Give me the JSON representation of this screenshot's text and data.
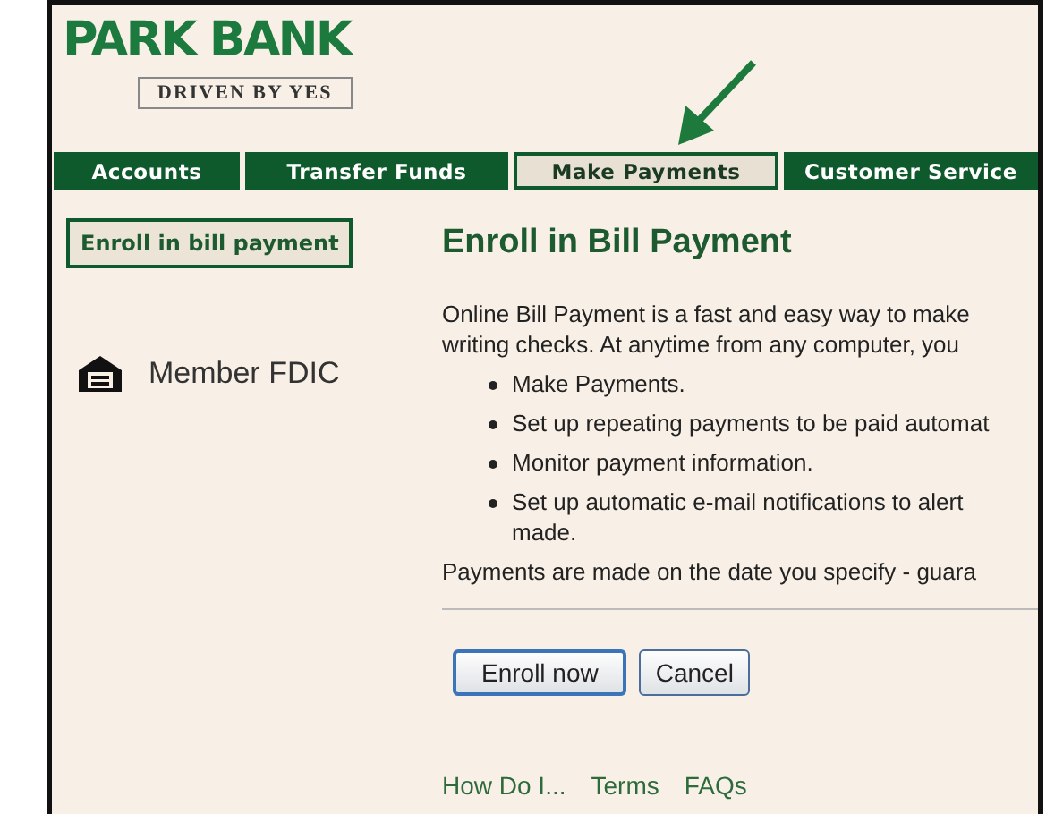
{
  "logo": {
    "name": "PARK BANK",
    "tagline": "DRIVEN BY YES"
  },
  "tabs": [
    {
      "label": "Accounts",
      "selected": false
    },
    {
      "label": "Transfer Funds",
      "selected": false
    },
    {
      "label": "Make Payments",
      "selected": true
    },
    {
      "label": "Customer Service",
      "selected": false
    }
  ],
  "sidebar": {
    "link": "Enroll in bill payment",
    "fdic": "Member FDIC"
  },
  "main": {
    "title": "Enroll in Bill Payment",
    "intro": [
      "Online Bill Payment is a fast and easy way to make",
      "writing checks. At anytime from any computer, you"
    ],
    "bullets": [
      [
        "Make Payments."
      ],
      [
        "Set up repeating payments to be paid automat"
      ],
      [
        "Monitor payment information."
      ],
      [
        "Set up automatic e-mail notifications to alert",
        "made."
      ]
    ],
    "note": "Payments are made on the date you specify - guara",
    "buttons": [
      {
        "label": "Enroll now",
        "kind": "default"
      },
      {
        "label": "Cancel",
        "kind": "normal"
      }
    ],
    "footer_links": [
      "How Do I...",
      "Terms",
      "FAQs"
    ]
  }
}
